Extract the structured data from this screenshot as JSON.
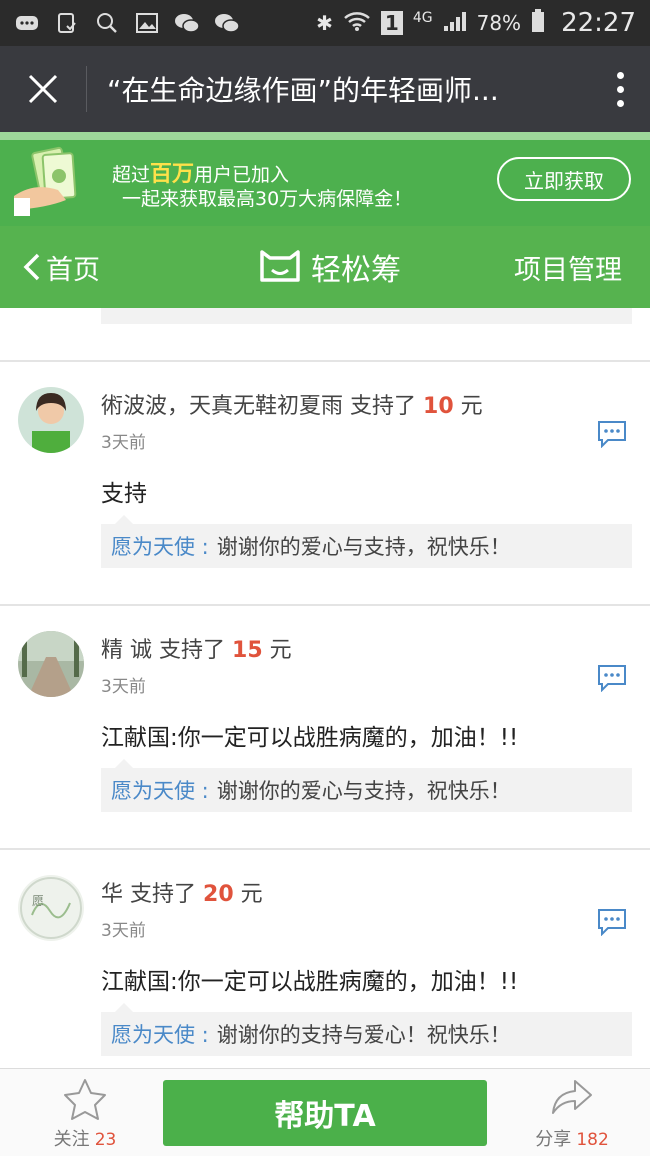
{
  "status_bar": {
    "signal_label": "4G",
    "sim": "1",
    "battery": "78%",
    "time": "22:27"
  },
  "title_bar": {
    "title": "“在生命边缘作画”的年轻画师..."
  },
  "banner": {
    "line1_prefix": "超过",
    "line1_highlight": "百万",
    "line1_suffix": "用户已加入",
    "line2": "一起来获取最高30万大病保障金！",
    "button": "立即获取"
  },
  "nav": {
    "back_label": "首页",
    "brand": "轻松筹",
    "right_label": "项目管理"
  },
  "comments": [
    {
      "name": "術波波，天真无鞋初夏雨",
      "action": "支持了",
      "amount": "10",
      "unit": "元",
      "time": "3天前",
      "body": "支持",
      "reply_by": "愿为天使 :",
      "reply_text": "谢谢你的爱心与支持，祝快乐！"
    },
    {
      "name": "精 诚",
      "action": "支持了",
      "amount": "15",
      "unit": "元",
      "time": "3天前",
      "body": "江献国:你一定可以战胜病魔的，加油！!!",
      "reply_by": "愿为天使 :",
      "reply_text": "谢谢你的爱心与支持，祝快乐！"
    },
    {
      "name": "华",
      "action": "支持了",
      "amount": "20",
      "unit": "元",
      "time": "3天前",
      "body": "江献国:你一定可以战胜病魔的，加油！!!",
      "reply_by": "愿为天使 :",
      "reply_text": "谢谢你的支持与爱心！祝快乐！"
    }
  ],
  "bottom_bar": {
    "follow_label": "关注",
    "follow_count": "23",
    "help_button": "帮助TA",
    "share_label": "分享",
    "share_count": "182"
  },
  "colors": {
    "brand_green": "#4db04e",
    "amount_red": "#e0533c",
    "reply_blue": "#4a89c8"
  }
}
